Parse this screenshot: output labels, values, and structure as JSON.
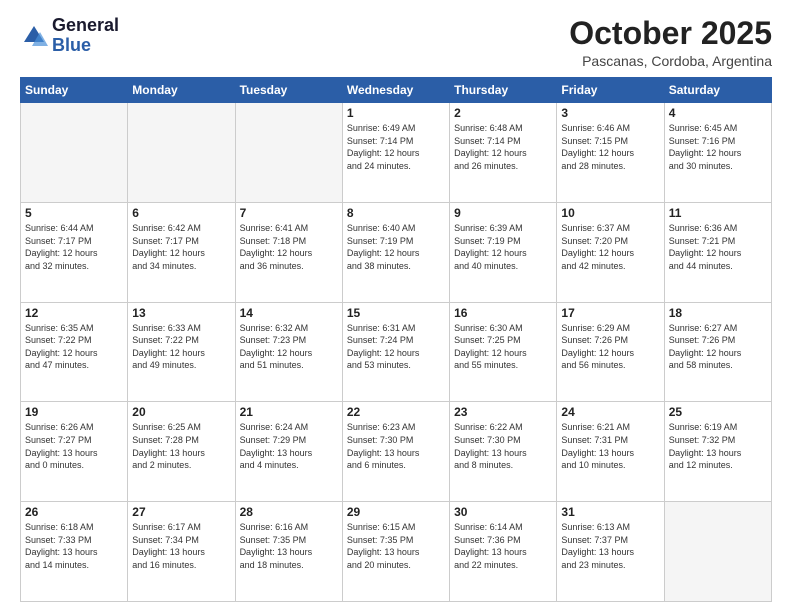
{
  "logo": {
    "general": "General",
    "blue": "Blue"
  },
  "header": {
    "month": "October 2025",
    "location": "Pascanas, Cordoba, Argentina"
  },
  "weekdays": [
    "Sunday",
    "Monday",
    "Tuesday",
    "Wednesday",
    "Thursday",
    "Friday",
    "Saturday"
  ],
  "weeks": [
    [
      {
        "day": "",
        "info": ""
      },
      {
        "day": "",
        "info": ""
      },
      {
        "day": "",
        "info": ""
      },
      {
        "day": "1",
        "info": "Sunrise: 6:49 AM\nSunset: 7:14 PM\nDaylight: 12 hours\nand 24 minutes."
      },
      {
        "day": "2",
        "info": "Sunrise: 6:48 AM\nSunset: 7:14 PM\nDaylight: 12 hours\nand 26 minutes."
      },
      {
        "day": "3",
        "info": "Sunrise: 6:46 AM\nSunset: 7:15 PM\nDaylight: 12 hours\nand 28 minutes."
      },
      {
        "day": "4",
        "info": "Sunrise: 6:45 AM\nSunset: 7:16 PM\nDaylight: 12 hours\nand 30 minutes."
      }
    ],
    [
      {
        "day": "5",
        "info": "Sunrise: 6:44 AM\nSunset: 7:17 PM\nDaylight: 12 hours\nand 32 minutes."
      },
      {
        "day": "6",
        "info": "Sunrise: 6:42 AM\nSunset: 7:17 PM\nDaylight: 12 hours\nand 34 minutes."
      },
      {
        "day": "7",
        "info": "Sunrise: 6:41 AM\nSunset: 7:18 PM\nDaylight: 12 hours\nand 36 minutes."
      },
      {
        "day": "8",
        "info": "Sunrise: 6:40 AM\nSunset: 7:19 PM\nDaylight: 12 hours\nand 38 minutes."
      },
      {
        "day": "9",
        "info": "Sunrise: 6:39 AM\nSunset: 7:19 PM\nDaylight: 12 hours\nand 40 minutes."
      },
      {
        "day": "10",
        "info": "Sunrise: 6:37 AM\nSunset: 7:20 PM\nDaylight: 12 hours\nand 42 minutes."
      },
      {
        "day": "11",
        "info": "Sunrise: 6:36 AM\nSunset: 7:21 PM\nDaylight: 12 hours\nand 44 minutes."
      }
    ],
    [
      {
        "day": "12",
        "info": "Sunrise: 6:35 AM\nSunset: 7:22 PM\nDaylight: 12 hours\nand 47 minutes."
      },
      {
        "day": "13",
        "info": "Sunrise: 6:33 AM\nSunset: 7:22 PM\nDaylight: 12 hours\nand 49 minutes."
      },
      {
        "day": "14",
        "info": "Sunrise: 6:32 AM\nSunset: 7:23 PM\nDaylight: 12 hours\nand 51 minutes."
      },
      {
        "day": "15",
        "info": "Sunrise: 6:31 AM\nSunset: 7:24 PM\nDaylight: 12 hours\nand 53 minutes."
      },
      {
        "day": "16",
        "info": "Sunrise: 6:30 AM\nSunset: 7:25 PM\nDaylight: 12 hours\nand 55 minutes."
      },
      {
        "day": "17",
        "info": "Sunrise: 6:29 AM\nSunset: 7:26 PM\nDaylight: 12 hours\nand 56 minutes."
      },
      {
        "day": "18",
        "info": "Sunrise: 6:27 AM\nSunset: 7:26 PM\nDaylight: 12 hours\nand 58 minutes."
      }
    ],
    [
      {
        "day": "19",
        "info": "Sunrise: 6:26 AM\nSunset: 7:27 PM\nDaylight: 13 hours\nand 0 minutes."
      },
      {
        "day": "20",
        "info": "Sunrise: 6:25 AM\nSunset: 7:28 PM\nDaylight: 13 hours\nand 2 minutes."
      },
      {
        "day": "21",
        "info": "Sunrise: 6:24 AM\nSunset: 7:29 PM\nDaylight: 13 hours\nand 4 minutes."
      },
      {
        "day": "22",
        "info": "Sunrise: 6:23 AM\nSunset: 7:30 PM\nDaylight: 13 hours\nand 6 minutes."
      },
      {
        "day": "23",
        "info": "Sunrise: 6:22 AM\nSunset: 7:30 PM\nDaylight: 13 hours\nand 8 minutes."
      },
      {
        "day": "24",
        "info": "Sunrise: 6:21 AM\nSunset: 7:31 PM\nDaylight: 13 hours\nand 10 minutes."
      },
      {
        "day": "25",
        "info": "Sunrise: 6:19 AM\nSunset: 7:32 PM\nDaylight: 13 hours\nand 12 minutes."
      }
    ],
    [
      {
        "day": "26",
        "info": "Sunrise: 6:18 AM\nSunset: 7:33 PM\nDaylight: 13 hours\nand 14 minutes."
      },
      {
        "day": "27",
        "info": "Sunrise: 6:17 AM\nSunset: 7:34 PM\nDaylight: 13 hours\nand 16 minutes."
      },
      {
        "day": "28",
        "info": "Sunrise: 6:16 AM\nSunset: 7:35 PM\nDaylight: 13 hours\nand 18 minutes."
      },
      {
        "day": "29",
        "info": "Sunrise: 6:15 AM\nSunset: 7:35 PM\nDaylight: 13 hours\nand 20 minutes."
      },
      {
        "day": "30",
        "info": "Sunrise: 6:14 AM\nSunset: 7:36 PM\nDaylight: 13 hours\nand 22 minutes."
      },
      {
        "day": "31",
        "info": "Sunrise: 6:13 AM\nSunset: 7:37 PM\nDaylight: 13 hours\nand 23 minutes."
      },
      {
        "day": "",
        "info": ""
      }
    ]
  ]
}
